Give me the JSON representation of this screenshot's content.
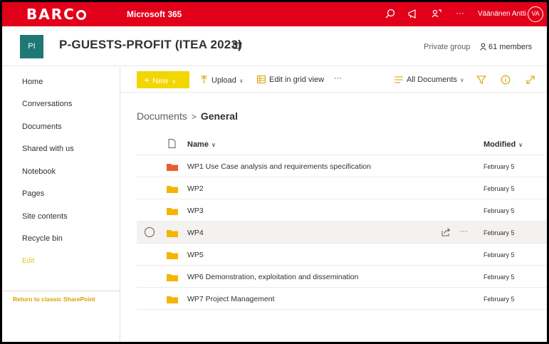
{
  "topbar": {
    "brand": "BARC",
    "app_name": "Microsoft 365",
    "user_name": "Väänänen Antti",
    "avatar_initials": "VA",
    "more_label": "···",
    "color": "#e2001a"
  },
  "site": {
    "tile_initials": "PI",
    "title": "P-GUESTS-PROFIT (ITEA 2023)",
    "privacy": "Private group",
    "members": "61 members"
  },
  "nav": {
    "items": [
      {
        "label": "Home"
      },
      {
        "label": "Conversations"
      },
      {
        "label": "Documents"
      },
      {
        "label": "Shared with us"
      },
      {
        "label": "Notebook"
      },
      {
        "label": "Pages"
      },
      {
        "label": "Site contents"
      },
      {
        "label": "Recycle bin"
      }
    ],
    "edit_label": "Edit",
    "classic_link": "Return to classic SharePoint"
  },
  "commandbar": {
    "new_label": "New",
    "upload_label": "Upload",
    "grid_label": "Edit in grid view",
    "more_label": "···",
    "view_label": "All Documents"
  },
  "breadcrumb": {
    "root": "Documents",
    "separator": ">",
    "current": "General"
  },
  "table": {
    "columns": {
      "name": "Name",
      "modified": "Modified"
    },
    "rows": [
      {
        "name": "WP1 Use Case analysis and requirements specification",
        "modified": "February 5",
        "folder_color": "#e8602c"
      },
      {
        "name": "WP2",
        "modified": "February 5",
        "folder_color": "#f4b400"
      },
      {
        "name": "WP3",
        "modified": "February 5",
        "folder_color": "#f4b400"
      },
      {
        "name": "WP4",
        "modified": "February 5",
        "folder_color": "#f4b400",
        "more": "···"
      },
      {
        "name": "WP5",
        "modified": "February 5",
        "folder_color": "#f4b400"
      },
      {
        "name": "WP6 Demonstration, exploitation and dissemination",
        "modified": "February 5",
        "folder_color": "#f4b400"
      },
      {
        "name": "WP7 Project Management",
        "modified": "February 5",
        "folder_color": "#f4b400"
      }
    ]
  },
  "accent": "#f2d600"
}
